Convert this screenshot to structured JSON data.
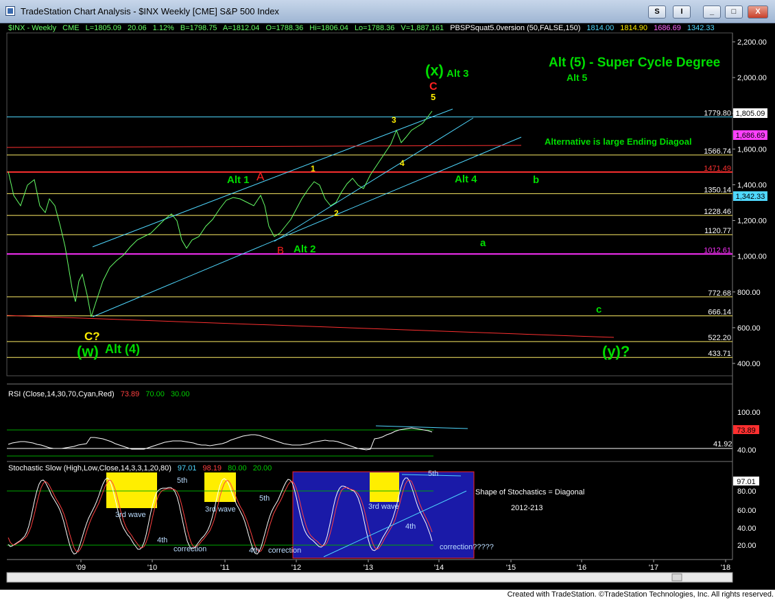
{
  "window": {
    "title": "TradeStation Chart Analysis - $INX Weekly [CME] S&P 500 Index",
    "btn_s": "S",
    "btn_i": "I",
    "btn_min": "_",
    "btn_max": "□",
    "btn_close": "X"
  },
  "header": {
    "symbol": "$INX - Weekly",
    "exchange": "CME",
    "last": "L=1805.09",
    "change": "20.06",
    "pct": "1.12%",
    "bid": "B=1798.75",
    "ask": "A=1812.04",
    "open": "O=1788.36",
    "hi": "Hi=1806.04",
    "lo": "Lo=1788.36",
    "vol": "V=1,887,161",
    "indicator": "PBSPSquat5.0version (50,FALSE,150)",
    "ind_v1": "1814.00",
    "ind_v2": "1814.90",
    "ind_v3": "1686.69",
    "ind_v4": "1342.33"
  },
  "price_axis": {
    "ticks": [
      "2,200.00",
      "2,000.00",
      "1,800.00",
      "1,600.00",
      "1,400.00",
      "1,200.00",
      "1,000.00",
      "800.00",
      "600.00",
      "400.00"
    ],
    "last_marker": "1,805.09",
    "marker_1686": "1,686.69",
    "marker_1342": "1,342.33"
  },
  "levels": [
    {
      "value": "1779.80",
      "color": "#ffffff"
    },
    {
      "value": "1566.74",
      "color": "#ffffff"
    },
    {
      "value": "1471.49",
      "color": "#ff3030"
    },
    {
      "value": "1350.14",
      "color": "#ffffff"
    },
    {
      "value": "1228.46",
      "color": "#ffffff"
    },
    {
      "value": "1120.77",
      "color": "#ffffff"
    },
    {
      "value": "1012.61",
      "color": "#ff30ff"
    },
    {
      "value": "772.68",
      "color": "#ffffff"
    },
    {
      "value": "666.14",
      "color": "#ffffff"
    },
    {
      "value": "522.20",
      "color": "#ffffff"
    },
    {
      "value": "433.71",
      "color": "#ffffff"
    }
  ],
  "annotations": {
    "alt5_super": "Alt (5) - Super Cycle Degree",
    "alt5": "Alt 5",
    "alt3": "Alt 3",
    "x_wave": "(x)",
    "c_red": "C",
    "five": "5",
    "ending_diag": "Alternative is large Ending Diagoal",
    "alt1": "Alt 1",
    "a_red": "A",
    "alt2": "Alt 2",
    "b_red": "B",
    "alt4": "Alt 4",
    "b_green": "b",
    "a_green": "a",
    "c_green": "c",
    "y_wave": "(y)?",
    "w_wave": "(w)",
    "alt4_paren": "Alt (4)",
    "c_question": "C?",
    "three": "3",
    "four": "4",
    "one": "1",
    "two": "2"
  },
  "rsi": {
    "label": "RSI (Close,14,30,70,Cyan,Red)",
    "v1": "73.89",
    "v2": "70.00",
    "v3": "30.00",
    "axis_100": "100.00",
    "axis_40": "40.00",
    "marker": "73.89",
    "level_41": "41.92"
  },
  "stoch": {
    "label": "Stochastic Slow (High,Low,Close,14,3,3,1,20,80)",
    "v1": "97.01",
    "v2": "98.19",
    "v3": "80.00",
    "v4": "20.00",
    "marker": "97.01",
    "axis": [
      "80.00",
      "60.00",
      "40.00",
      "20.00"
    ],
    "third_wave": "3rd wave",
    "fifth": "5th",
    "fourth": "4th",
    "correction": "correction",
    "correction_q": "correction?????",
    "shape_note": "Shape of Stochastics = Diagonal",
    "years_note": "2012-213"
  },
  "x_axis": [
    "'09",
    "'10",
    "'11",
    "'12",
    "'13",
    "'14",
    "'15",
    "'16",
    "'17",
    "'18"
  ],
  "status": {
    "credit": "Created with TradeStation. ©TradeStation Technologies, Inc. All rights reserved."
  },
  "colors": {
    "background": "#000000",
    "green_label": "#00dd00",
    "yellow_label": "#ffee00",
    "red_label": "#ff2020",
    "cyan_line": "#4fd8ff"
  }
}
